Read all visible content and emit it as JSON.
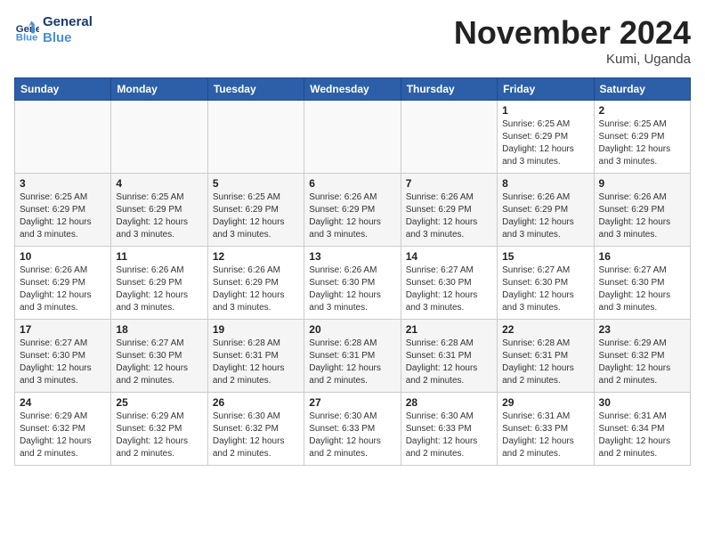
{
  "header": {
    "logo_line1": "General",
    "logo_line2": "Blue",
    "month": "November 2024",
    "location": "Kumi, Uganda"
  },
  "days_of_week": [
    "Sunday",
    "Monday",
    "Tuesday",
    "Wednesday",
    "Thursday",
    "Friday",
    "Saturday"
  ],
  "weeks": [
    [
      {
        "num": "",
        "info": ""
      },
      {
        "num": "",
        "info": ""
      },
      {
        "num": "",
        "info": ""
      },
      {
        "num": "",
        "info": ""
      },
      {
        "num": "",
        "info": ""
      },
      {
        "num": "1",
        "info": "Sunrise: 6:25 AM\nSunset: 6:29 PM\nDaylight: 12 hours and 3 minutes."
      },
      {
        "num": "2",
        "info": "Sunrise: 6:25 AM\nSunset: 6:29 PM\nDaylight: 12 hours and 3 minutes."
      }
    ],
    [
      {
        "num": "3",
        "info": "Sunrise: 6:25 AM\nSunset: 6:29 PM\nDaylight: 12 hours and 3 minutes."
      },
      {
        "num": "4",
        "info": "Sunrise: 6:25 AM\nSunset: 6:29 PM\nDaylight: 12 hours and 3 minutes."
      },
      {
        "num": "5",
        "info": "Sunrise: 6:25 AM\nSunset: 6:29 PM\nDaylight: 12 hours and 3 minutes."
      },
      {
        "num": "6",
        "info": "Sunrise: 6:26 AM\nSunset: 6:29 PM\nDaylight: 12 hours and 3 minutes."
      },
      {
        "num": "7",
        "info": "Sunrise: 6:26 AM\nSunset: 6:29 PM\nDaylight: 12 hours and 3 minutes."
      },
      {
        "num": "8",
        "info": "Sunrise: 6:26 AM\nSunset: 6:29 PM\nDaylight: 12 hours and 3 minutes."
      },
      {
        "num": "9",
        "info": "Sunrise: 6:26 AM\nSunset: 6:29 PM\nDaylight: 12 hours and 3 minutes."
      }
    ],
    [
      {
        "num": "10",
        "info": "Sunrise: 6:26 AM\nSunset: 6:29 PM\nDaylight: 12 hours and 3 minutes."
      },
      {
        "num": "11",
        "info": "Sunrise: 6:26 AM\nSunset: 6:29 PM\nDaylight: 12 hours and 3 minutes."
      },
      {
        "num": "12",
        "info": "Sunrise: 6:26 AM\nSunset: 6:29 PM\nDaylight: 12 hours and 3 minutes."
      },
      {
        "num": "13",
        "info": "Sunrise: 6:26 AM\nSunset: 6:30 PM\nDaylight: 12 hours and 3 minutes."
      },
      {
        "num": "14",
        "info": "Sunrise: 6:27 AM\nSunset: 6:30 PM\nDaylight: 12 hours and 3 minutes."
      },
      {
        "num": "15",
        "info": "Sunrise: 6:27 AM\nSunset: 6:30 PM\nDaylight: 12 hours and 3 minutes."
      },
      {
        "num": "16",
        "info": "Sunrise: 6:27 AM\nSunset: 6:30 PM\nDaylight: 12 hours and 3 minutes."
      }
    ],
    [
      {
        "num": "17",
        "info": "Sunrise: 6:27 AM\nSunset: 6:30 PM\nDaylight: 12 hours and 3 minutes."
      },
      {
        "num": "18",
        "info": "Sunrise: 6:27 AM\nSunset: 6:30 PM\nDaylight: 12 hours and 2 minutes."
      },
      {
        "num": "19",
        "info": "Sunrise: 6:28 AM\nSunset: 6:31 PM\nDaylight: 12 hours and 2 minutes."
      },
      {
        "num": "20",
        "info": "Sunrise: 6:28 AM\nSunset: 6:31 PM\nDaylight: 12 hours and 2 minutes."
      },
      {
        "num": "21",
        "info": "Sunrise: 6:28 AM\nSunset: 6:31 PM\nDaylight: 12 hours and 2 minutes."
      },
      {
        "num": "22",
        "info": "Sunrise: 6:28 AM\nSunset: 6:31 PM\nDaylight: 12 hours and 2 minutes."
      },
      {
        "num": "23",
        "info": "Sunrise: 6:29 AM\nSunset: 6:32 PM\nDaylight: 12 hours and 2 minutes."
      }
    ],
    [
      {
        "num": "24",
        "info": "Sunrise: 6:29 AM\nSunset: 6:32 PM\nDaylight: 12 hours and 2 minutes."
      },
      {
        "num": "25",
        "info": "Sunrise: 6:29 AM\nSunset: 6:32 PM\nDaylight: 12 hours and 2 minutes."
      },
      {
        "num": "26",
        "info": "Sunrise: 6:30 AM\nSunset: 6:32 PM\nDaylight: 12 hours and 2 minutes."
      },
      {
        "num": "27",
        "info": "Sunrise: 6:30 AM\nSunset: 6:33 PM\nDaylight: 12 hours and 2 minutes."
      },
      {
        "num": "28",
        "info": "Sunrise: 6:30 AM\nSunset: 6:33 PM\nDaylight: 12 hours and 2 minutes."
      },
      {
        "num": "29",
        "info": "Sunrise: 6:31 AM\nSunset: 6:33 PM\nDaylight: 12 hours and 2 minutes."
      },
      {
        "num": "30",
        "info": "Sunrise: 6:31 AM\nSunset: 6:34 PM\nDaylight: 12 hours and 2 minutes."
      }
    ]
  ]
}
